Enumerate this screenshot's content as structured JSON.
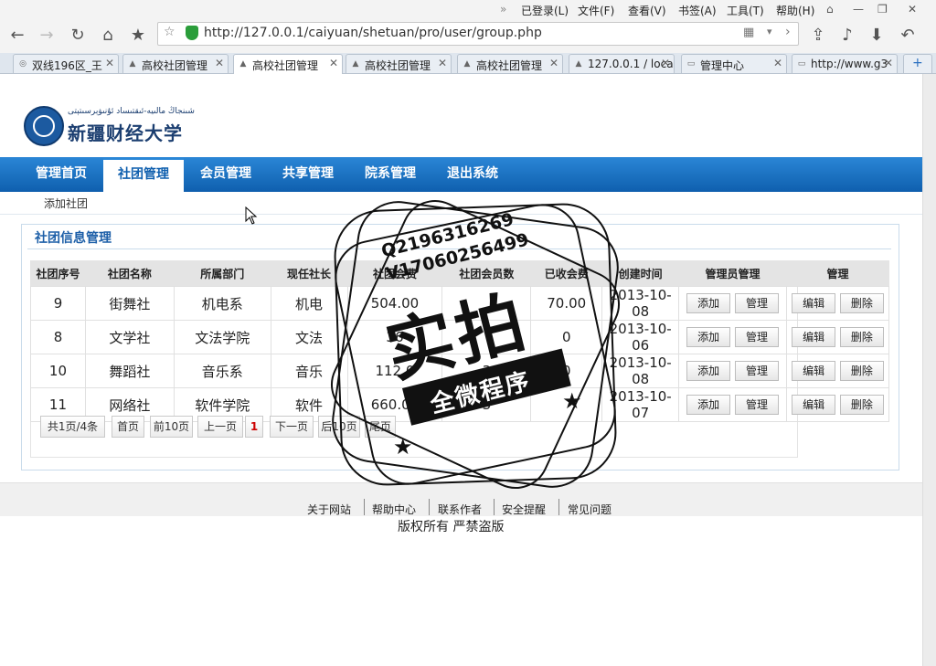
{
  "browser": {
    "menu": [
      "已登录(L)",
      "文件(F)",
      "查看(V)",
      "书签(A)",
      "工具(T)",
      "帮助(H)"
    ],
    "address": "http://127.0.0.1/caiyuan/shetuan/pro/user/group.php",
    "tabs": [
      {
        "label": "双线196区_王"
      },
      {
        "label": "高校社团管理"
      },
      {
        "label": "高校社团管理"
      },
      {
        "label": "高校社团管理"
      },
      {
        "label": "高校社团管理"
      },
      {
        "label": "127.0.0.1 / loca"
      },
      {
        "label": "管理中心"
      },
      {
        "label": "http://www.g3"
      }
    ]
  },
  "site": {
    "logo_text": "新疆财经大学",
    "logo_sub": "شىنجاڭ مالىيە-ئىقتىساد ئۇنىۋېرسىتېتى",
    "nav": [
      "管理首页",
      "社团管理",
      "会员管理",
      "共享管理",
      "院系管理",
      "退出系统"
    ],
    "subnav": "添加社团",
    "panel_title": "社团信息管理",
    "table": {
      "headers": [
        "社团序号",
        "社团名称",
        "所属部门",
        "现任社长",
        "社团会费",
        "社团会员数",
        "已收会费",
        "创建时间",
        "管理员管理",
        "管理"
      ],
      "rows": [
        {
          "id": "9",
          "name": "街舞社",
          "dept": "机电系",
          "leader": "机电",
          "fee": "504.00",
          "members": "",
          "collected": "70.00",
          "created": "2013-10-08"
        },
        {
          "id": "8",
          "name": "文学社",
          "dept": "文法学院",
          "leader": "文法",
          "fee": "36",
          "members": "",
          "collected": "0",
          "created": "2013-10-06"
        },
        {
          "id": "10",
          "name": "舞蹈社",
          "dept": "音乐系",
          "leader": "音乐",
          "fee": "112.0",
          "members": "3",
          "collected": "0",
          "created": "2013-10-08"
        },
        {
          "id": "11",
          "name": "网络社",
          "dept": "软件学院",
          "leader": "软件",
          "fee": "660.00",
          "members": "3",
          "collected": "",
          "created": "2013-10-07"
        }
      ],
      "btn_add": "添加",
      "btn_manage": "管理",
      "btn_edit": "编辑",
      "btn_delete": "删除"
    },
    "pager": {
      "summary": "共1页/4条",
      "first": "首页",
      "prev10": "前10页",
      "prev": "上一页",
      "current": "1",
      "next": "下一页",
      "next10": "后10页",
      "last": "尾页"
    },
    "footer_links": [
      "关于网站",
      "帮助中心",
      "联系作者",
      "安全提醒",
      "常见问题"
    ],
    "copyright": "版权所有 严禁盗版"
  },
  "stamp": {
    "qq1": "Q2196316269",
    "qq2": "V17060256499",
    "main": "实拍",
    "band": "全微程序"
  }
}
